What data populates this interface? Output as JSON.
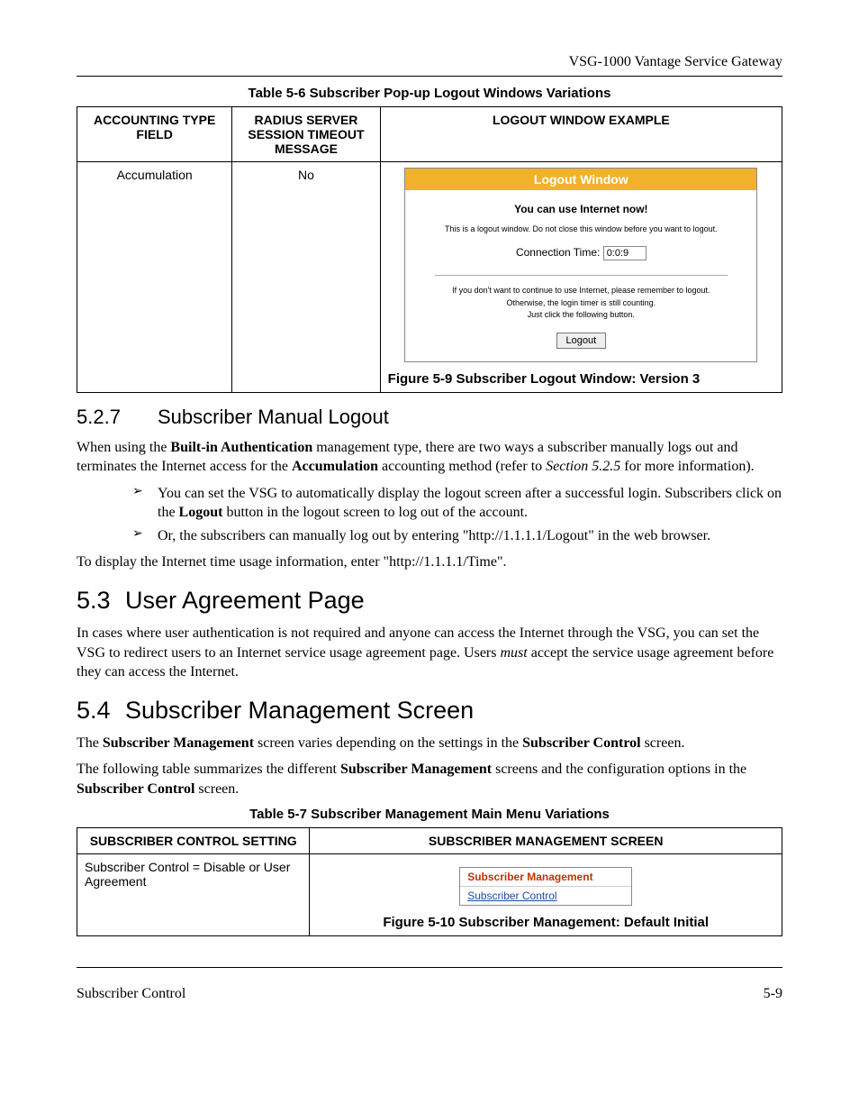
{
  "running_head": "VSG-1000 Vantage Service Gateway",
  "table1": {
    "caption": "Table 5-6 Subscriber Pop-up Logout Windows Variations",
    "headers": [
      "ACCOUNTING TYPE FIELD",
      "RADIUS SERVER SESSION TIMEOUT MESSAGE",
      "LOGOUT WINDOW EXAMPLE"
    ],
    "row": {
      "col1": "Accumulation",
      "col2": "No",
      "figure_caption": "Figure 5-9 Subscriber Logout Window: Version 3",
      "logout_window": {
        "title": "Logout Window",
        "main_line": "You can use Internet now!",
        "sub_line": "This is a logout window. Do not close this window before you want to logout.",
        "conn_label": "Connection Time:",
        "conn_value": "0:0:9",
        "note_line1": "If you don't want to continue to use Internet, please remember to logout.",
        "note_line2": "Otherwise, the login timer is still counting.",
        "note_line3": "Just click the following button.",
        "button": "Logout"
      }
    }
  },
  "sec527": {
    "no": "5.2.7",
    "title": "Subscriber Manual Logout",
    "p1_a": "When using the ",
    "p1_bold1": "Built-in Authentication",
    "p1_b": " management type, there are two ways a subscriber manually logs out and terminates the Internet access for the ",
    "p1_bold2": "Accumulation",
    "p1_c": " accounting method (refer to ",
    "p1_em": "Section 5.2.5",
    "p1_d": " for more information).",
    "li1_a": "You can set the VSG to automatically display the logout screen after a successful login. Subscribers click on the ",
    "li1_bold": "Logout",
    "li1_b": " button in the logout screen to log out of the account.",
    "li2": "Or, the subscribers can manually log out by entering \"http://1.1.1.1/Logout\" in the web browser.",
    "p2": "To display the Internet time usage information, enter \"http://1.1.1.1/Time\"."
  },
  "sec53": {
    "no": "5.3",
    "title": "User Agreement Page",
    "p1_a": "In cases where user authentication is not required and anyone can access the Internet through the VSG, you can set the VSG to redirect users to an Internet service usage agreement page. Users ",
    "p1_em": "must",
    "p1_b": " accept the service usage agreement before they can access the Internet."
  },
  "sec54": {
    "no": "5.4",
    "title": "Subscriber Management Screen",
    "p1_a": "The ",
    "p1_bold1": "Subscriber Management",
    "p1_b": " screen varies depending on the settings in the ",
    "p1_bold2": "Subscriber Control",
    "p1_c": " screen.",
    "p2_a": "The following table summarizes the different ",
    "p2_bold1": "Subscriber Management",
    "p2_b": " screens and the configuration options in the ",
    "p2_bold2": "Subscriber Control",
    "p2_c": " screen."
  },
  "table2": {
    "caption": "Table 5-7 Subscriber Management Main Menu Variations",
    "headers": [
      "SUBSCRIBER CONTROL SETTING",
      "SUBSCRIBER MANAGEMENT SCREEN"
    ],
    "row": {
      "col1": "Subscriber Control = Disable or User Agreement",
      "figure_caption": "Figure 5-10 Subscriber Management: Default Initial",
      "sm_box": {
        "header": "Subscriber Management",
        "link": "Subscriber Control"
      }
    }
  },
  "footer": {
    "left": "Subscriber Control",
    "right": "5-9"
  }
}
